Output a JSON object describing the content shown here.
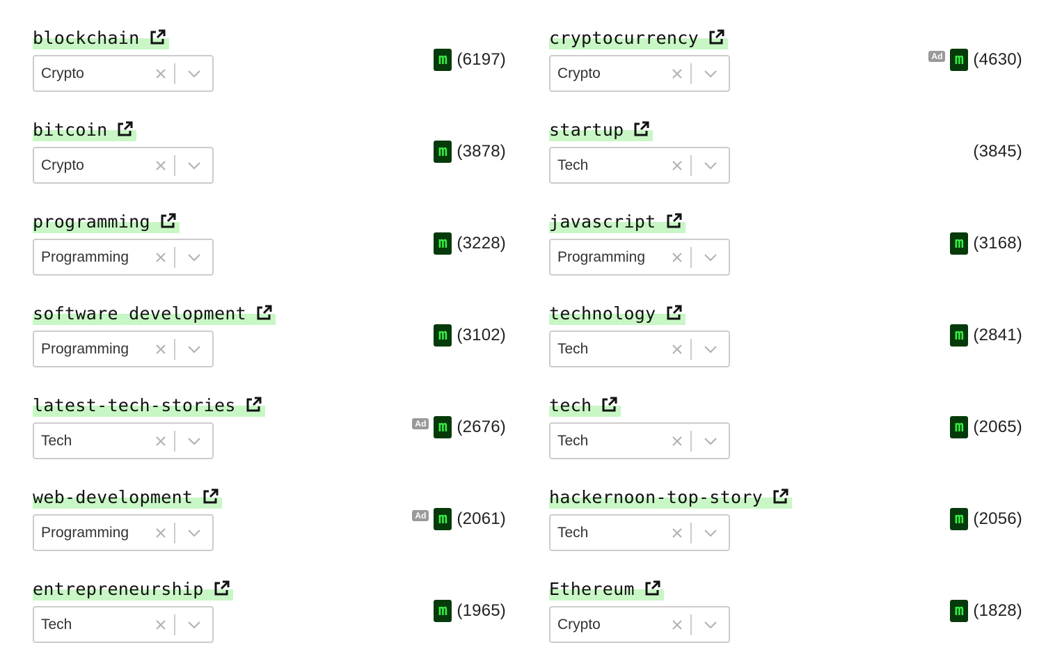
{
  "columns": [
    {
      "rows": [
        {
          "tag": "blockchain",
          "category": "Crypto",
          "ad": false,
          "medium": true,
          "count": "(6197)"
        },
        {
          "tag": "bitcoin",
          "category": "Crypto",
          "ad": false,
          "medium": true,
          "count": "(3878)"
        },
        {
          "tag": "programming",
          "category": "Programming",
          "ad": false,
          "medium": true,
          "count": "(3228)"
        },
        {
          "tag": "software development",
          "category": "Programming",
          "ad": false,
          "medium": true,
          "count": "(3102)"
        },
        {
          "tag": "latest-tech-stories",
          "category": "Tech",
          "ad": true,
          "medium": true,
          "count": "(2676)"
        },
        {
          "tag": "web-development",
          "category": "Programming",
          "ad": true,
          "medium": true,
          "count": "(2061)"
        },
        {
          "tag": "entrepreneurship",
          "category": "Tech",
          "ad": false,
          "medium": true,
          "count": "(1965)"
        }
      ]
    },
    {
      "rows": [
        {
          "tag": "cryptocurrency",
          "category": "Crypto",
          "ad": true,
          "medium": true,
          "count": "(4630)"
        },
        {
          "tag": "startup",
          "category": "Tech",
          "ad": false,
          "medium": false,
          "count": "(3845)"
        },
        {
          "tag": "javascript",
          "category": "Programming",
          "ad": false,
          "medium": true,
          "count": "(3168)"
        },
        {
          "tag": "technology",
          "category": "Tech",
          "ad": false,
          "medium": true,
          "count": "(2841)"
        },
        {
          "tag": "tech",
          "category": "Tech",
          "ad": false,
          "medium": true,
          "count": "(2065)"
        },
        {
          "tag": "hackernoon-top-story",
          "category": "Tech",
          "ad": false,
          "medium": true,
          "count": "(2056)"
        },
        {
          "tag": "Ethereum",
          "category": "Crypto",
          "ad": false,
          "medium": true,
          "count": "(1828)"
        }
      ]
    }
  ],
  "badges": {
    "ad_label": "Ad",
    "medium_label": "m"
  },
  "colors": {
    "highlight": "#c8f7c5",
    "medium_bg": "#073a0b",
    "medium_fg": "#36f044",
    "ad_bg": "#9a9a9a",
    "select_border": "#cccccc"
  },
  "icons": {
    "external_link": "external-link-icon",
    "clear": "clear-x-icon",
    "dropdown": "chevron-down-icon"
  }
}
